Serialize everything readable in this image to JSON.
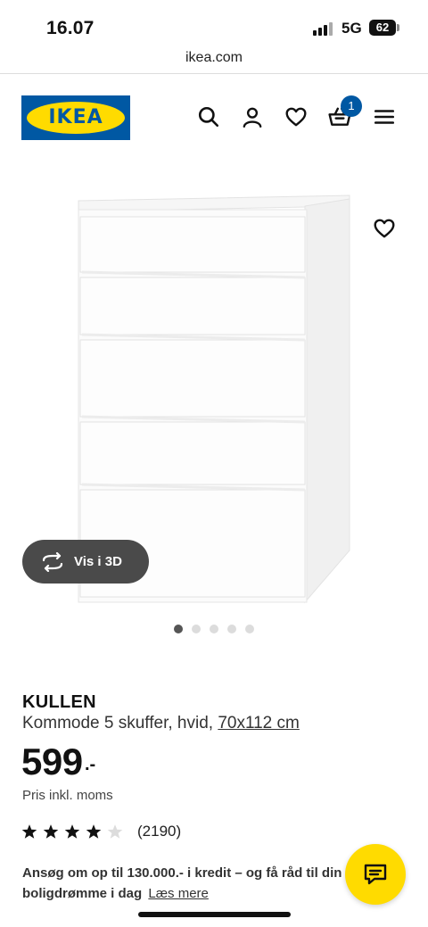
{
  "status_bar": {
    "time": "16.07",
    "network": "5G",
    "battery": "62"
  },
  "browser": {
    "url": "ikea.com"
  },
  "header": {
    "logo_text": "IKEA",
    "cart_count": "1",
    "icons": [
      "search-icon",
      "account-icon",
      "heart-icon",
      "cart-icon",
      "menu-icon"
    ]
  },
  "gallery": {
    "view_3d_label": "Vis i 3D",
    "image_count": 5,
    "active_index": 0
  },
  "product": {
    "name": "KULLEN",
    "description": "Kommode 5 skuffer, hvid,",
    "size_link": "70x112 cm",
    "price": "599",
    "price_suffix": ".-",
    "price_note": "Pris inkl. moms",
    "rating": 4,
    "rating_max": 5,
    "review_count": "(2190)"
  },
  "credit": {
    "text": "Ansøg om op til 130.000.- i kredit – og få råd til din",
    "text_line2": "boligdrømme i dag",
    "link": "Læs mere"
  },
  "colors": {
    "ikea_blue": "#0058a3",
    "ikea_yellow": "#ffdb00",
    "button_3d_bg": "#4a4a4a"
  }
}
